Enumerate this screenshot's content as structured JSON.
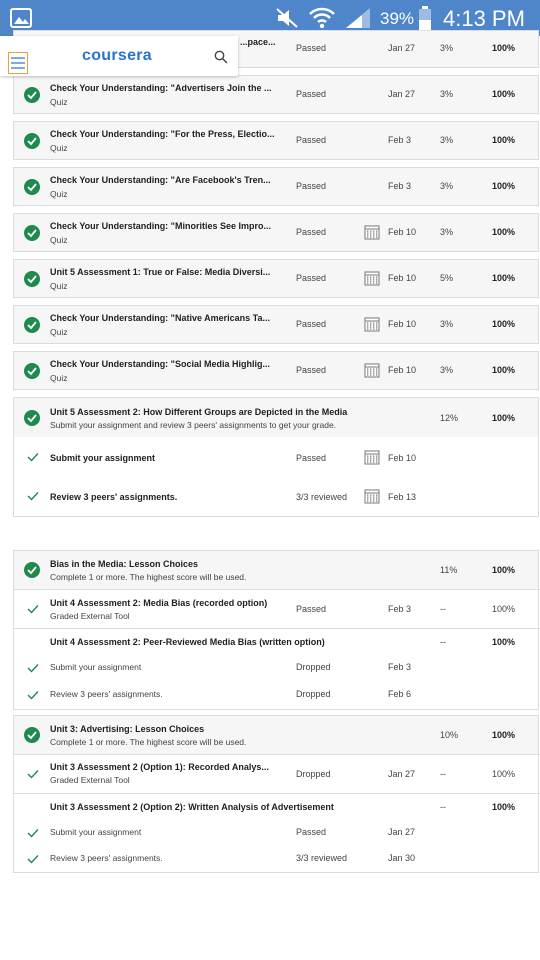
{
  "statusbar": {
    "battery": "39%",
    "time": "4:13 PM"
  },
  "header": {
    "logo": "coursera"
  },
  "items": [
    {
      "title": "Check Your Understanding: \"Advertisers Join the ...",
      "sub": "Quiz",
      "status": "Passed",
      "date": "Jan 27",
      "weight": "3%",
      "grade": "100%",
      "cal": false
    },
    {
      "title": "Check Your Understanding: \"For the Press, Electio...",
      "sub": "Quiz",
      "status": "Passed",
      "date": "Feb 3",
      "weight": "3%",
      "grade": "100%",
      "cal": false
    },
    {
      "title": "Check Your Understanding: \"Are Facebook's Tren...",
      "sub": "Quiz",
      "status": "Passed",
      "date": "Feb 3",
      "weight": "3%",
      "grade": "100%",
      "cal": false
    },
    {
      "title": "Check Your Understanding: \"Minorities See Impro...",
      "sub": "Quiz",
      "status": "Passed",
      "date": "Feb 10",
      "weight": "3%",
      "grade": "100%",
      "cal": true
    },
    {
      "title": "Unit 5 Assessment 1: True or False: Media Diversi...",
      "sub": "Quiz",
      "status": "Passed",
      "date": "Feb 10",
      "weight": "5%",
      "grade": "100%",
      "cal": true
    },
    {
      "title": "Check Your Understanding: \"Native Americans Ta...",
      "sub": "Quiz",
      "status": "Passed",
      "date": "Feb 10",
      "weight": "3%",
      "grade": "100%",
      "cal": true
    },
    {
      "title": "Check Your Understanding: \"Social Media Highlig...",
      "sub": "Quiz",
      "status": "Passed",
      "date": "Feb 10",
      "weight": "3%",
      "grade": "100%",
      "cal": true
    }
  ],
  "top_partial": {
    "title": "...pace...",
    "status": "Passed",
    "date": "Jan 27",
    "weight": "3%",
    "grade": "100%"
  },
  "unit5a2": {
    "title": "Unit 5 Assessment 2: How Different Groups are Depicted in the Media",
    "sub": "Submit your assignment and review 3 peers' assignments to get your grade.",
    "weight": "12%",
    "grade": "100%",
    "steps": [
      {
        "label": "Submit your assignment",
        "status": "Passed",
        "date": "Feb 10"
      },
      {
        "label": "Review 3 peers' assignments.",
        "status": "3/3 reviewed",
        "date": "Feb 13"
      }
    ]
  },
  "bias": {
    "title": "Bias in the Media: Lesson Choices",
    "sub": "Complete 1 or more. The highest score will be used.",
    "weight": "11%",
    "grade": "100%",
    "opt1": {
      "title": "Unit 4 Assessment 2: Media Bias (recorded option)",
      "sub": "Graded External Tool",
      "status": "Passed",
      "date": "Feb 3",
      "weight": "--",
      "grade": "100%"
    },
    "opt2": {
      "title": "Unit 4 Assessment 2: Peer-Reviewed Media Bias (written option)",
      "weight": "--",
      "grade": "100%",
      "steps": [
        {
          "label": "Submit your assignment",
          "status": "Dropped",
          "date": "Feb 3"
        },
        {
          "label": "Review 3 peers' assignments.",
          "status": "Dropped",
          "date": "Feb 6"
        }
      ]
    }
  },
  "advert": {
    "title": "Unit 3: Advertising: Lesson Choices",
    "sub": "Complete 1 or more. The highest score will be used.",
    "weight": "10%",
    "grade": "100%",
    "opt1": {
      "title": "Unit 3 Assessment 2 (Option 1): Recorded Analys...",
      "sub": "Graded External Tool",
      "status": "Dropped",
      "date": "Jan 27",
      "weight": "--",
      "grade": "100%"
    },
    "opt2": {
      "title": "Unit 3 Assessment 2 (Option 2): Written Analysis of Advertisement",
      "weight": "--",
      "grade": "100%",
      "steps": [
        {
          "label": "Submit your assignment",
          "status": "Passed",
          "date": "Jan 27"
        },
        {
          "label": "Review 3 peers' assignments.",
          "status": "3/3 reviewed",
          "date": "Jan 30"
        }
      ]
    }
  },
  "colors": {
    "statusbar": "#4f86c9",
    "check": "#1e8a4c",
    "brand": "#2a73cc"
  }
}
